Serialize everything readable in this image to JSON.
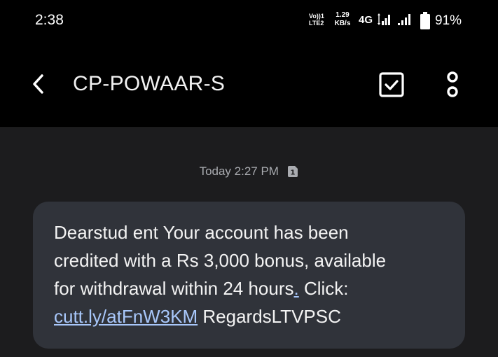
{
  "status_bar": {
    "time": "2:38",
    "volte_line1": "Vo))1",
    "volte_line2": "LTE2",
    "speed_value": "1.29",
    "speed_unit": "KB/s",
    "network_type": "4G",
    "battery_percent": "91%",
    "battery_level": 0.91
  },
  "toolbar": {
    "back_icon": "chevron-left-icon",
    "title": "CP-POWAAR-S",
    "select_icon": "checkbox-icon",
    "more_icon": "more-vert-icon"
  },
  "thread": {
    "timestamp": "Today 2:27 PM",
    "sim_badge": "1",
    "message": {
      "line1": "Dearstud ent Your account has been",
      "line2": "credited with a Rs 3,000 bonus, available",
      "line3_text": "for withdrawal within 24 hours",
      "line3_link": ".",
      "line3_tail": " Click:",
      "link": "cutt.ly/atFnW3KM",
      "tail": " RegardsLTVPSC"
    }
  },
  "colors": {
    "background": "#000000",
    "thread_background": "#1c1c1e",
    "bubble": "#30333a",
    "link": "#a8c7fa",
    "timestamp": "#a9abb0"
  }
}
